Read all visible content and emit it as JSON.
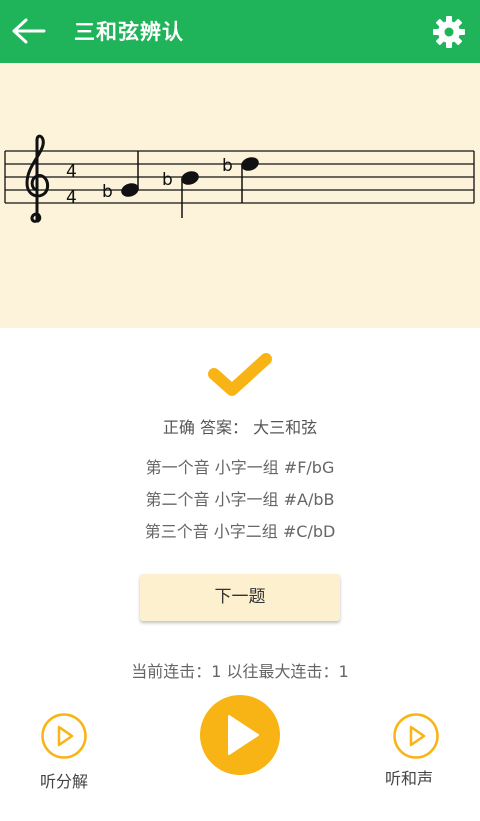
{
  "header": {
    "title": "三和弦辨认",
    "accent_color": "#1fb35a"
  },
  "staff": {
    "time_signature": {
      "top": "4",
      "bottom": "4"
    },
    "notes": [
      {
        "accidental": "b"
      },
      {
        "accidental": "b"
      },
      {
        "accidental": "b"
      }
    ],
    "background_color": "#fcf3da"
  },
  "result": {
    "icon": "checkmark-icon",
    "answer_text": "正确 答案： 大三和弦",
    "notes": [
      "第一个音 小字一组 #F/bG",
      "第二个音 小字一组 #A/bB",
      "第三个音 小字二组 #C/bD"
    ]
  },
  "next_button": {
    "label": "下一题"
  },
  "streak_text": "当前连击：1 以往最大连击：1",
  "controls": {
    "left_label": "听分解",
    "right_label": "听和声",
    "accent_color": "#f8b414"
  }
}
